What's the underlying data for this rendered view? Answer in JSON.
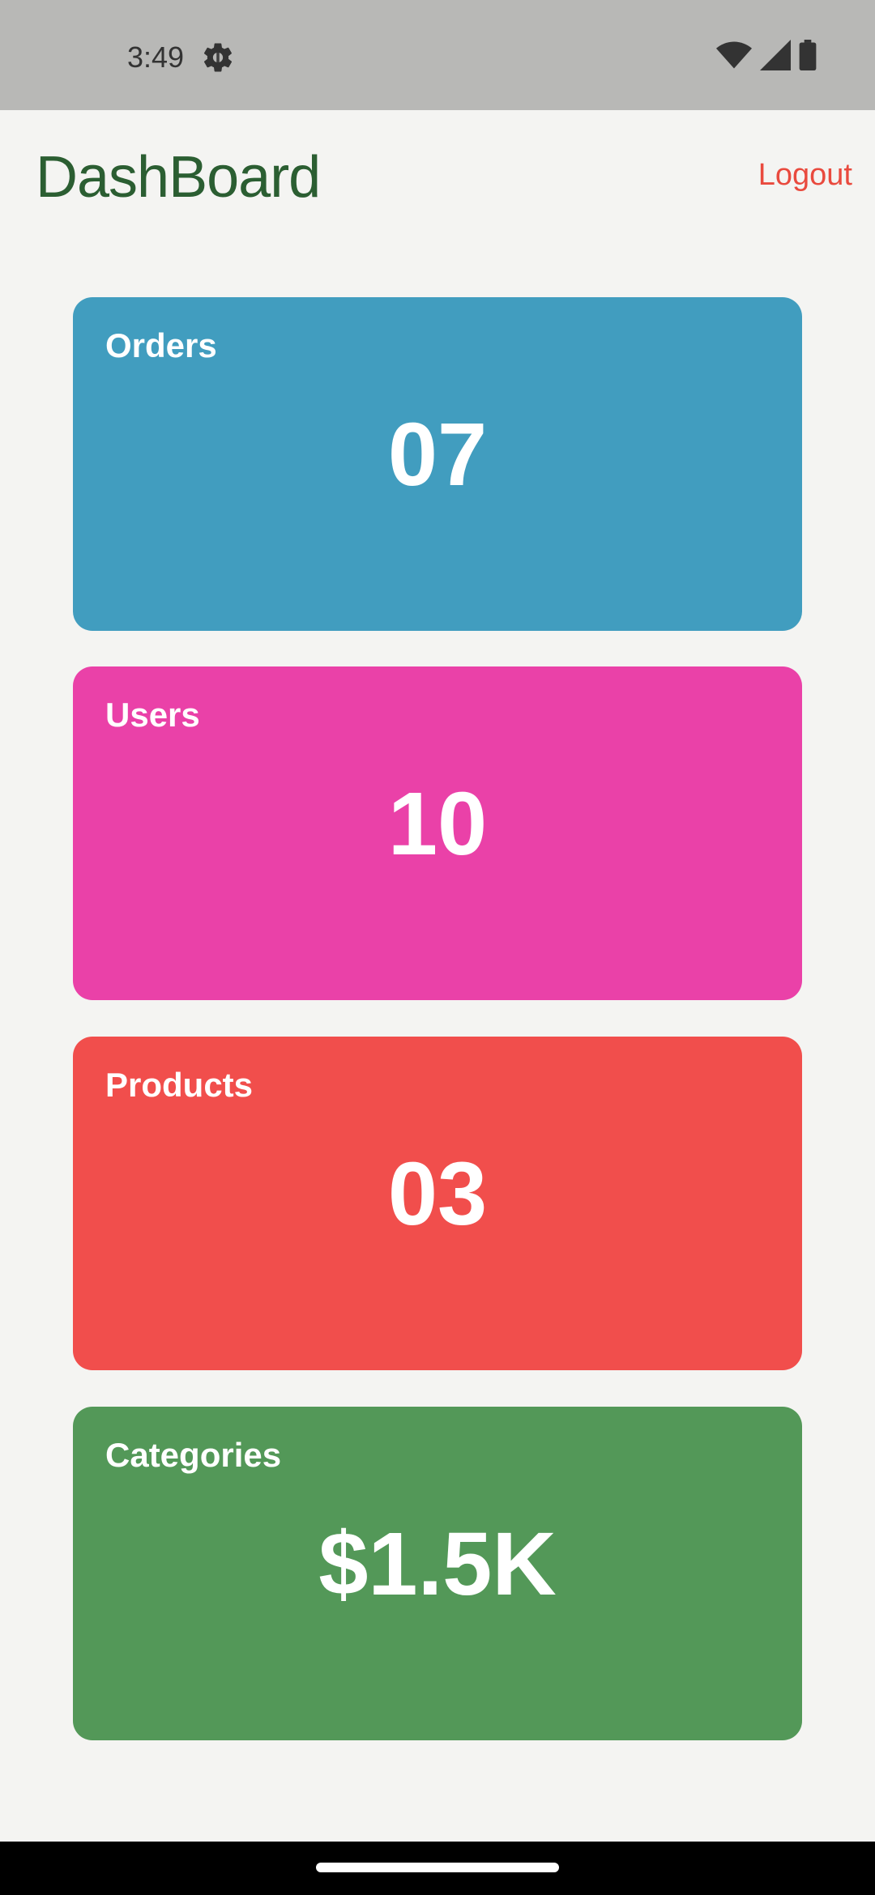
{
  "status_bar": {
    "time": "3:49",
    "icons": [
      "settings-gear-icon",
      "wifi-icon",
      "cell-signal-icon",
      "battery-icon"
    ]
  },
  "header": {
    "title": "DashBoard",
    "logout_label": "Logout",
    "title_color": "#2b5e32",
    "logout_color": "#e94a3e"
  },
  "cards": [
    {
      "label": "Orders",
      "value": "07",
      "color": "#419dbf"
    },
    {
      "label": "Users",
      "value": "10",
      "color": "#ea41a8"
    },
    {
      "label": "Products",
      "value": "03",
      "color": "#f14e4c"
    },
    {
      "label": "Categories",
      "value": "$1.5K",
      "color": "#539858"
    }
  ]
}
